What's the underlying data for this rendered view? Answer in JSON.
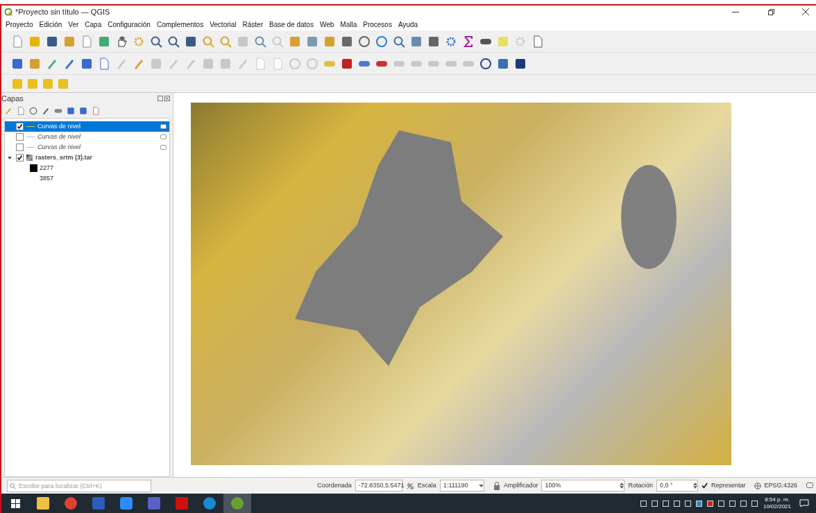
{
  "window": {
    "title": "*Proyecto sin título — QGIS"
  },
  "menu": [
    "Proyecto",
    "Edición",
    "Ver",
    "Capa",
    "Configuración",
    "Complementos",
    "Vectorial",
    "Ráster",
    "Base de datos",
    "Web",
    "Malla",
    "Procesos",
    "Ayuda"
  ],
  "layers_panel": {
    "title": "Capas",
    "layers": [
      {
        "kind": "vector",
        "label": "Curvas de nivel",
        "checked": true,
        "selected": true
      },
      {
        "kind": "vector",
        "label": "Curvas de nivel",
        "checked": false,
        "selected": false
      },
      {
        "kind": "vector",
        "label": "Curvas de nivel",
        "checked": false,
        "selected": false
      },
      {
        "kind": "raster",
        "label": "rasters_srtm (3).tar",
        "checked": true,
        "selected": false,
        "expanded": true,
        "children": [
          {
            "label": "2277",
            "color": "#000000"
          },
          {
            "label": "3857"
          }
        ]
      }
    ]
  },
  "locator": {
    "placeholder": "Escribe para localizar (Ctrl+K)"
  },
  "status_bar": {
    "coordinate_label": "Coordenada",
    "coordinate": "-72.8350,5.5471",
    "scale_label": "Escala",
    "scale": "1:111190",
    "magnifier_label": "Amplificador",
    "magnifier": "100%",
    "rotation_label": "Rotación",
    "rotation": "0,0 °",
    "render_label": "Representar",
    "render_checked": true,
    "crs": "EPSG:4326"
  },
  "taskbar": {
    "apps": [
      {
        "kind": "explorer",
        "selected": false
      },
      {
        "kind": "chrome",
        "selected": false
      },
      {
        "kind": "word",
        "selected": false
      },
      {
        "kind": "zoom",
        "selected": false
      },
      {
        "kind": "teams",
        "selected": false
      },
      {
        "kind": "acrobat",
        "selected": false
      },
      {
        "kind": "edge",
        "selected": false
      },
      {
        "kind": "qgis",
        "selected": true
      }
    ],
    "time": "8:54 p. m.",
    "date": "10/02/2021"
  }
}
